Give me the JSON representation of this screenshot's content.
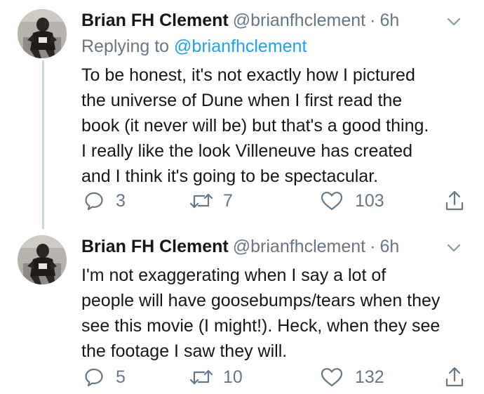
{
  "tweets": [
    {
      "author_name": "Brian FH Clement",
      "author_handle": "@brianfhclement",
      "separator": "·",
      "time": "6h",
      "replying_prefix": "Replying to",
      "replying_to": "@brianfhclement",
      "lines": [
        "To be honest, it's not exactly how I pictured",
        "the universe of Dune when I first read the",
        "book (it never will be) but that's a good thing.",
        "I really like the look Villeneuve has created",
        "and I think it's going to be spectacular."
      ],
      "replies": "3",
      "retweets": "7",
      "likes": "103"
    },
    {
      "author_name": "Brian FH Clement",
      "author_handle": "@brianfhclement",
      "separator": "·",
      "time": "6h",
      "lines": [
        "I'm not exaggerating when I say a lot of",
        "people will have goosebumps/tears when they",
        "see this movie (I might!). Heck, when they see",
        "the footage I saw they will."
      ],
      "replies": "5",
      "retweets": "10",
      "likes": "132"
    }
  ],
  "icons": {
    "reply": "reply-icon",
    "retweet": "retweet-icon",
    "like": "heart-icon",
    "share": "share-icon",
    "more": "chevron-down-icon"
  },
  "colors": {
    "text": "#14171a",
    "secondary": "#657786",
    "link": "#1da1f2",
    "thread_line": "#ccd6dd"
  }
}
